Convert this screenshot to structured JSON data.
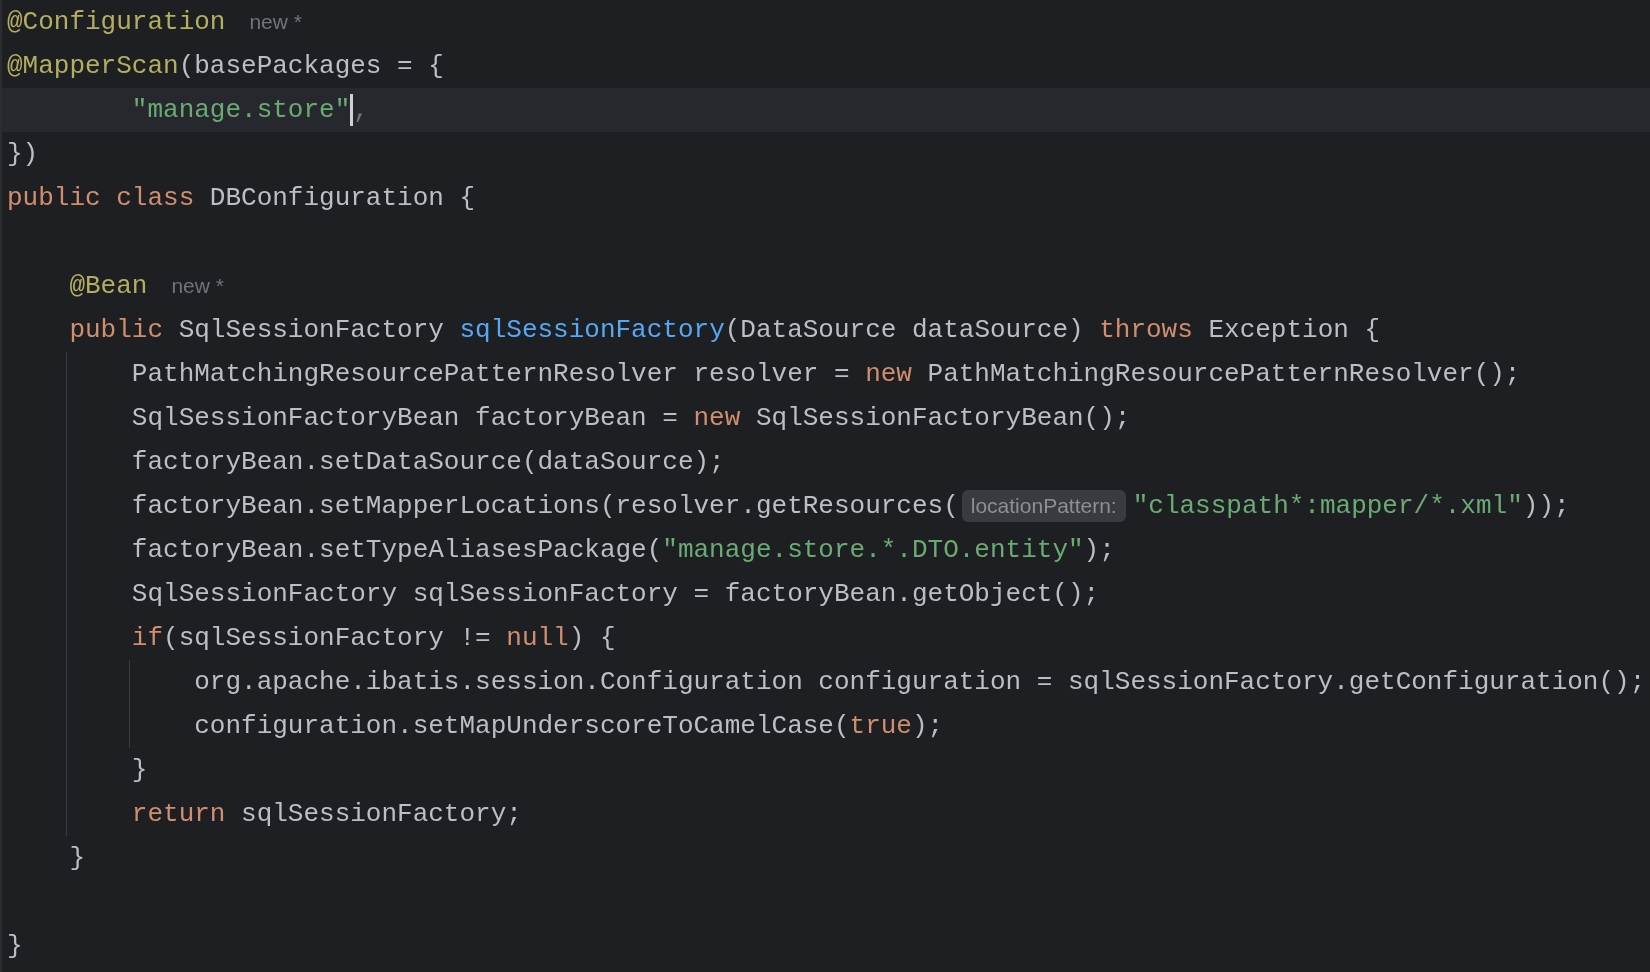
{
  "editor": {
    "lines": [
      {
        "current": false,
        "tokens": [
          {
            "kind": "annotation",
            "text": "@Configuration"
          },
          {
            "kind": "hint",
            "text": "new *"
          }
        ]
      },
      {
        "current": false,
        "tokens": [
          {
            "kind": "annotation",
            "text": "@MapperScan"
          },
          {
            "kind": "plain",
            "text": "(basePackages = {"
          }
        ]
      },
      {
        "current": true,
        "tokens": [
          {
            "kind": "string",
            "text": "        \"manage.store\""
          },
          {
            "kind": "caret"
          },
          {
            "kind": "dim",
            "text": ","
          }
        ]
      },
      {
        "current": false,
        "tokens": [
          {
            "kind": "plain",
            "text": "})"
          }
        ]
      },
      {
        "current": false,
        "tokens": [
          {
            "kind": "keyword",
            "text": "public class"
          },
          {
            "kind": "plain",
            "text": " DBConfiguration {"
          }
        ]
      },
      {
        "current": false
      },
      {
        "current": false,
        "tokens": [
          {
            "kind": "annotation",
            "text": "    @Bean"
          },
          {
            "kind": "hint",
            "text": "new *"
          }
        ]
      },
      {
        "current": false,
        "tokens": [
          {
            "kind": "keyword",
            "text": "    public"
          },
          {
            "kind": "plain",
            "text": " SqlSessionFactory "
          },
          {
            "kind": "function",
            "text": "sqlSessionFactory"
          },
          {
            "kind": "plain",
            "text": "(DataSource dataSource) "
          },
          {
            "kind": "keyword",
            "text": "throws"
          },
          {
            "kind": "plain",
            "text": " Exception {"
          }
        ]
      },
      {
        "current": false,
        "tokens": [
          {
            "kind": "plain",
            "text": "        PathMatchingResourcePatternResolver resolver = "
          },
          {
            "kind": "keyword",
            "text": "new"
          },
          {
            "kind": "plain",
            "text": " PathMatchingResourcePatternResolver();"
          }
        ]
      },
      {
        "current": false,
        "tokens": [
          {
            "kind": "plain",
            "text": "        SqlSessionFactoryBean factoryBean = "
          },
          {
            "kind": "keyword",
            "text": "new"
          },
          {
            "kind": "plain",
            "text": " SqlSessionFactoryBean();"
          }
        ]
      },
      {
        "current": false,
        "tokens": [
          {
            "kind": "plain",
            "text": "        factoryBean.setDataSource(dataSource);"
          }
        ]
      },
      {
        "current": false,
        "tokens": [
          {
            "kind": "plain",
            "text": "        factoryBean.setMapperLocations(resolver.getResources("
          },
          {
            "kind": "inlay",
            "text": "locationPattern:"
          },
          {
            "kind": "string",
            "text": "\"classpath*:mapper/*.xml\""
          },
          {
            "kind": "plain",
            "text": "));"
          }
        ]
      },
      {
        "current": false,
        "tokens": [
          {
            "kind": "plain",
            "text": "        factoryBean.setTypeAliasesPackage("
          },
          {
            "kind": "string",
            "text": "\"manage.store.*.DTO.entity\""
          },
          {
            "kind": "plain",
            "text": ");"
          }
        ]
      },
      {
        "current": false,
        "tokens": [
          {
            "kind": "plain",
            "text": "        SqlSessionFactory sqlSessionFactory = factoryBean.getObject();"
          }
        ]
      },
      {
        "current": false,
        "tokens": [
          {
            "kind": "keyword",
            "text": "        if"
          },
          {
            "kind": "plain",
            "text": "(sqlSessionFactory != "
          },
          {
            "kind": "keyword",
            "text": "null"
          },
          {
            "kind": "plain",
            "text": ") {"
          }
        ]
      },
      {
        "current": false,
        "tokens": [
          {
            "kind": "plain",
            "text": "            org.apache.ibatis.session.Configuration configuration = sqlSessionFactory.getConfiguration();"
          }
        ]
      },
      {
        "current": false,
        "tokens": [
          {
            "kind": "plain",
            "text": "            configuration.setMapUnderscoreToCamelCase("
          },
          {
            "kind": "keyword",
            "text": "true"
          },
          {
            "kind": "plain",
            "text": ");"
          }
        ]
      },
      {
        "current": false,
        "tokens": [
          {
            "kind": "plain",
            "text": "        }"
          }
        ]
      },
      {
        "current": false,
        "tokens": [
          {
            "kind": "keyword",
            "text": "        return"
          },
          {
            "kind": "plain",
            "text": " sqlSessionFactory;"
          }
        ]
      },
      {
        "current": false,
        "tokens": [
          {
            "kind": "plain",
            "text": "    }"
          }
        ]
      },
      {
        "current": false
      },
      {
        "current": false,
        "tokens": [
          {
            "kind": "plain",
            "text": "}"
          }
        ]
      }
    ]
  }
}
